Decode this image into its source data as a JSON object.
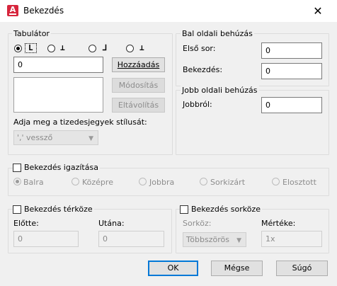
{
  "window": {
    "title": "Bekezdés",
    "close_label": "✕",
    "app_icon_letter": "A"
  },
  "tabulator": {
    "group_title": "Tabulátor",
    "types": [
      "L",
      "⊥",
      "⅃",
      "⊥"
    ],
    "value": "0",
    "add_button": "Hozzáadás",
    "modify_button": "Módosítás",
    "remove_button": "Eltávolítás",
    "decimal_label": "Adja meg a tizedesjegyek stílusát:",
    "decimal_value": "',' vessző"
  },
  "left_indent": {
    "group_title": "Bal oldali behúzás",
    "first_line_label": "Első sor:",
    "first_line_value": "0",
    "paragraph_label": "Bekezdés:",
    "paragraph_value": "0"
  },
  "right_indent": {
    "group_title": "Jobb oldali behúzás",
    "right_label": "Jobbról:",
    "right_value": "0"
  },
  "alignment": {
    "group_title": "Bekezdés igazítása",
    "options": [
      "Balra",
      "Középre",
      "Jobbra",
      "Sorkizárt",
      "Elosztott"
    ]
  },
  "spacing": {
    "group_title": "Bekezdés térköze",
    "before_label": "Előtte:",
    "before_value": "0",
    "after_label": "Utána:",
    "after_value": "0"
  },
  "line_spacing": {
    "group_title": "Bekezdés sorköze",
    "linespace_label": "Sorköz:",
    "linespace_value": "Többszörös",
    "amount_label": "Mértéke:",
    "amount_value": "1x"
  },
  "footer": {
    "ok": "OK",
    "cancel": "Mégse",
    "help": "Súgó"
  }
}
